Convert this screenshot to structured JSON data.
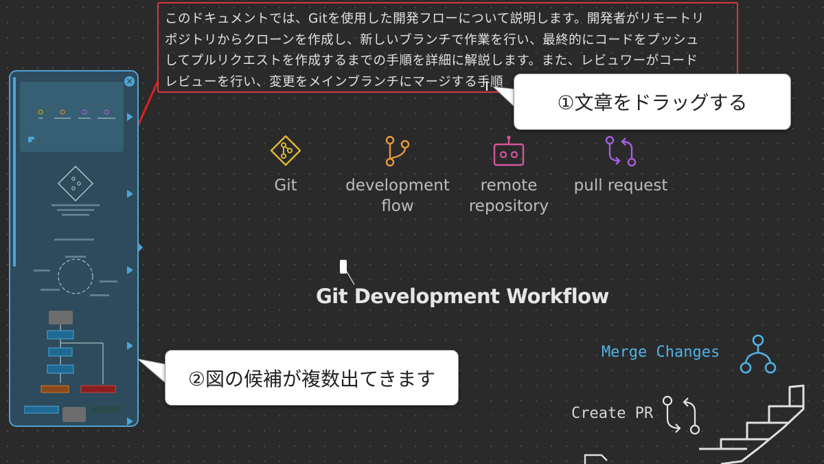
{
  "document": {
    "lines": [
      "このドキュメントでは、Gitを使用した開発フローについて説明します。開発者がリモートリ",
      "ポジトリからクローンを作成し、新しいブランチで作業を行い、最終的にコードをプッシュ",
      "してプルリクエストを作成するまでの手順を詳細に解説します。また、レビュワーがコード",
      "レビューを行い、変更をメインブランチにマージする手順"
    ]
  },
  "callouts": {
    "step1": "①文章をドラッグする",
    "step2": "②図の候補が複数出てきます"
  },
  "diagram": {
    "icons": [
      {
        "name": "git-icon",
        "label": "Git",
        "color": "#e0b92e"
      },
      {
        "name": "branch-icon",
        "label": "development flow",
        "color": "#e89a3a"
      },
      {
        "name": "remote-icon",
        "label": "remote repository",
        "color": "#d4579b"
      },
      {
        "name": "pull-request-icon",
        "label": "pull request",
        "color": "#a55fe0"
      }
    ],
    "title": "Git Development Workflow",
    "merge_label": "Merge Changes",
    "merge_color": "#4fb3e6",
    "pr_label": "Create PR"
  },
  "panel": {
    "close_icon": "close-icon",
    "accent": "#4fa5d6"
  }
}
